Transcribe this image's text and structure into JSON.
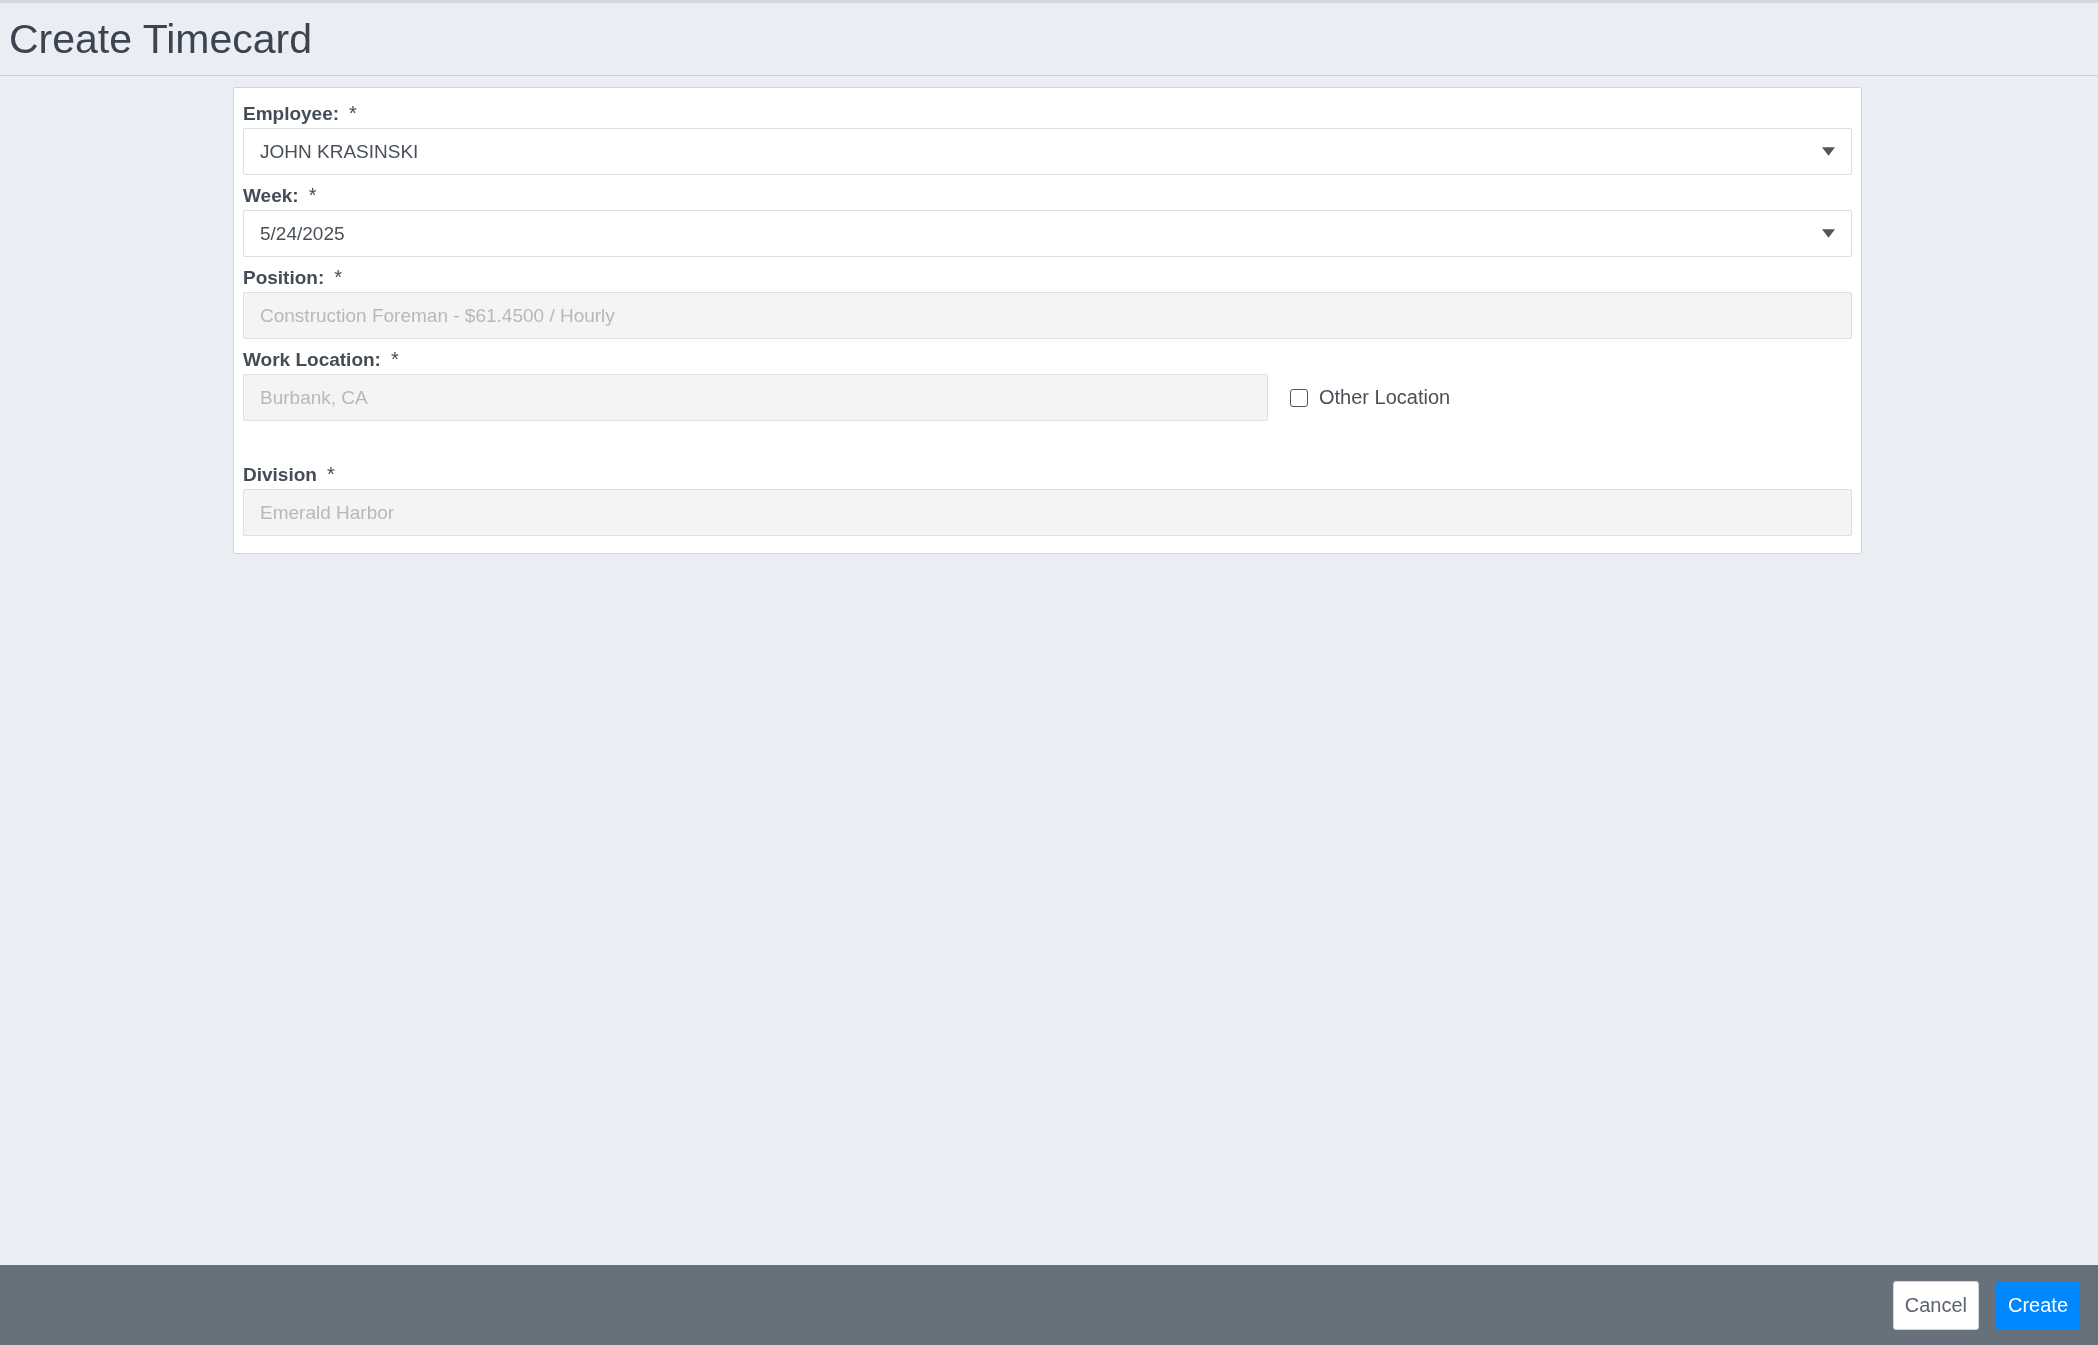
{
  "page": {
    "title": "Create Timecard"
  },
  "form": {
    "fields": [
      {
        "kind": "select",
        "label": "Employee:",
        "required_mark": "*",
        "value": "JOHN KRASINSKI"
      },
      {
        "kind": "select",
        "label": "Week:",
        "required_mark": "*",
        "value": "5/24/2025"
      },
      {
        "kind": "readonly",
        "label": "Position:",
        "required_mark": "*",
        "value": "Construction Foreman - $61.4500 / Hourly"
      },
      {
        "kind": "readonly",
        "label": "Work Location:",
        "required_mark": "*",
        "value": "Burbank, CA",
        "option": {
          "label": "Other Location",
          "checked": false
        }
      },
      {
        "kind": "readonly",
        "label": "Division",
        "required_mark": "*",
        "value": "Emerald Harbor"
      }
    ]
  },
  "footer": {
    "buttons": [
      {
        "kind": "secondary",
        "label": "Cancel"
      },
      {
        "kind": "primary",
        "label": "Create"
      }
    ]
  }
}
